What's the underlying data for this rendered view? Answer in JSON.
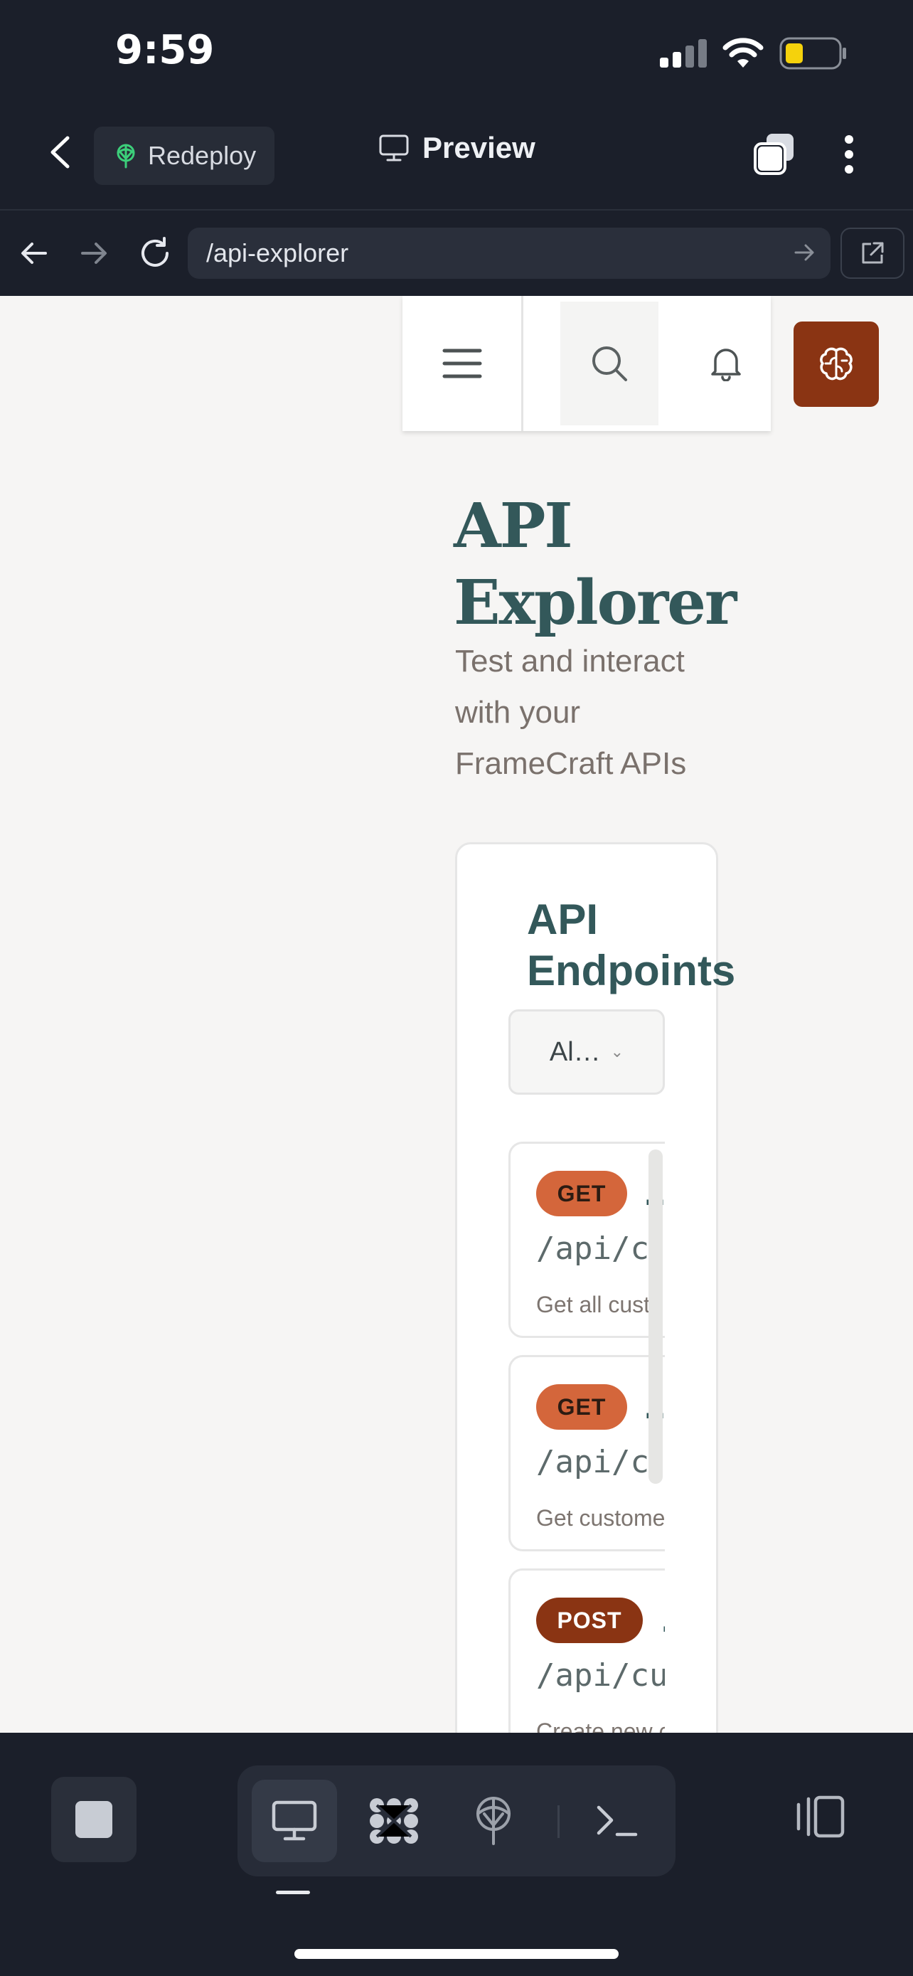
{
  "status_bar": {
    "time": "9:59"
  },
  "app_header": {
    "redeploy_label": "Redeploy",
    "title": "Preview"
  },
  "browser": {
    "url": "/api-explorer"
  },
  "page": {
    "title": "API Explorer",
    "subtitle": "Test and interact with your FrameCraft APIs"
  },
  "card": {
    "title": "API Endpoints",
    "filter_value": "Al…",
    "endpoints": [
      {
        "method": "GET",
        "name_fragment": "…",
        "path": "/api/c",
        "description": "Get all cust"
      },
      {
        "method": "GET",
        "name_fragment": "…",
        "path": "/api/c",
        "description": "Get custome"
      },
      {
        "method": "POST",
        "name_fragment": "…",
        "path": "/api/cu",
        "description": "Create new c"
      }
    ]
  },
  "colors": {
    "accent": "#8a3413",
    "get_badge": "#d4663b",
    "heading": "#33585a",
    "chrome_bg": "#1b1f2a"
  },
  "icons": {
    "header": [
      "back-chevron-icon",
      "redeploy-icon",
      "monitor-icon",
      "tabs-icon",
      "more-vertical-icon"
    ],
    "browser": [
      "arrow-left-icon",
      "arrow-right-icon",
      "reload-icon",
      "go-arrow-icon",
      "external-link-icon"
    ],
    "webview": [
      "menu-icon",
      "search-icon",
      "bell-icon",
      "brain-icon"
    ],
    "toolbar": [
      "stop-icon",
      "monitor-icon",
      "workflow-icon",
      "deploy-icon",
      "terminal-icon",
      "panel-icon"
    ]
  }
}
